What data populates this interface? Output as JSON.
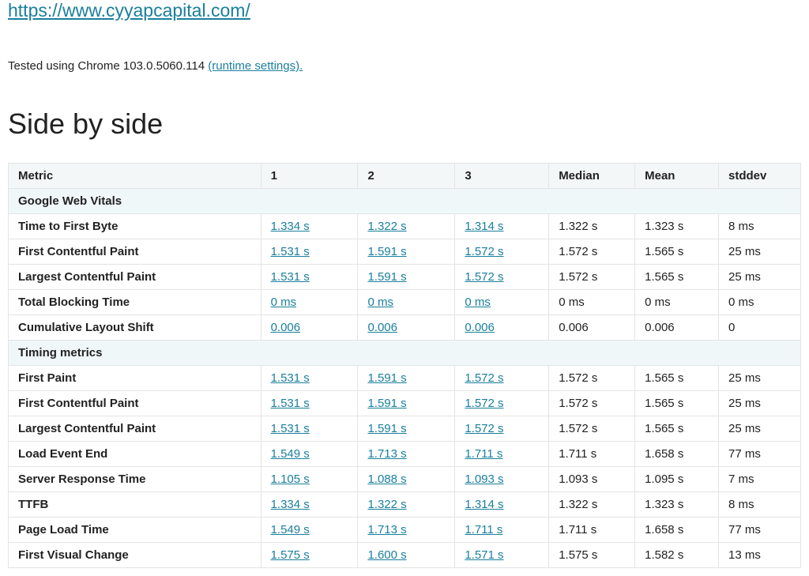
{
  "url_text": "https://www.cyyapcapital.com/",
  "tested_prefix": "Tested using Chrome 103.0.5060.114 ",
  "runtime_link": "(runtime settings).",
  "side_by_side_heading": "Side by side",
  "columns": {
    "metric": "Metric",
    "r1": "1",
    "r2": "2",
    "r3": "3",
    "median": "Median",
    "mean": "Mean",
    "stddev": "stddev"
  },
  "sections": [
    {
      "title": "Google Web Vitals",
      "rows": [
        {
          "metric": "Time to First Byte",
          "r1": "1.334 s",
          "r2": "1.322 s",
          "r3": "1.314 s",
          "median": "1.322 s",
          "mean": "1.323 s",
          "stddev": "8 ms"
        },
        {
          "metric": "First Contentful Paint",
          "r1": "1.531 s",
          "r2": "1.591 s",
          "r3": "1.572 s",
          "median": "1.572 s",
          "mean": "1.565 s",
          "stddev": "25 ms"
        },
        {
          "metric": "Largest Contentful Paint",
          "r1": "1.531 s",
          "r2": "1.591 s",
          "r3": "1.572 s",
          "median": "1.572 s",
          "mean": "1.565 s",
          "stddev": "25 ms"
        },
        {
          "metric": "Total Blocking Time",
          "r1": "0 ms",
          "r2": "0 ms",
          "r3": "0 ms",
          "median": "0 ms",
          "mean": "0 ms",
          "stddev": "0 ms"
        },
        {
          "metric": "Cumulative Layout Shift",
          "r1": "0.006",
          "r2": "0.006",
          "r3": "0.006",
          "median": "0.006",
          "mean": "0.006",
          "stddev": "0"
        }
      ]
    },
    {
      "title": "Timing metrics",
      "rows": [
        {
          "metric": "First Paint",
          "r1": "1.531 s",
          "r2": "1.591 s",
          "r3": "1.572 s",
          "median": "1.572 s",
          "mean": "1.565 s",
          "stddev": "25 ms"
        },
        {
          "metric": "First Contentful Paint",
          "r1": "1.531 s",
          "r2": "1.591 s",
          "r3": "1.572 s",
          "median": "1.572 s",
          "mean": "1.565 s",
          "stddev": "25 ms"
        },
        {
          "metric": "Largest Contentful Paint",
          "r1": "1.531 s",
          "r2": "1.591 s",
          "r3": "1.572 s",
          "median": "1.572 s",
          "mean": "1.565 s",
          "stddev": "25 ms"
        },
        {
          "metric": "Load Event End",
          "r1": "1.549 s",
          "r2": "1.713 s",
          "r3": "1.711 s",
          "median": "1.711 s",
          "mean": "1.658 s",
          "stddev": "77 ms"
        },
        {
          "metric": "Server Response Time",
          "r1": "1.105 s",
          "r2": "1.088 s",
          "r3": "1.093 s",
          "median": "1.093 s",
          "mean": "1.095 s",
          "stddev": "7 ms"
        },
        {
          "metric": "TTFB",
          "r1": "1.334 s",
          "r2": "1.322 s",
          "r3": "1.314 s",
          "median": "1.322 s",
          "mean": "1.323 s",
          "stddev": "8 ms"
        },
        {
          "metric": "Page Load Time",
          "r1": "1.549 s",
          "r2": "1.713 s",
          "r3": "1.711 s",
          "median": "1.711 s",
          "mean": "1.658 s",
          "stddev": "77 ms"
        },
        {
          "metric": "First Visual Change",
          "r1": "1.575 s",
          "r2": "1.600 s",
          "r3": "1.571 s",
          "median": "1.575 s",
          "mean": "1.582 s",
          "stddev": "13 ms"
        }
      ]
    }
  ]
}
